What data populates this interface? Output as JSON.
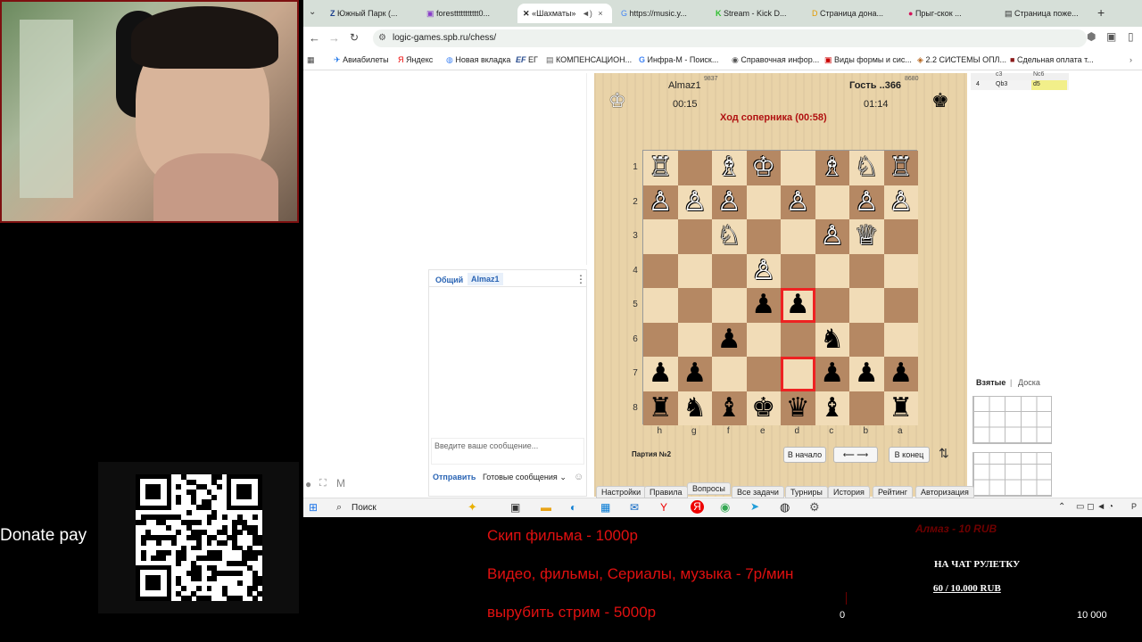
{
  "webcam": {},
  "browser": {
    "tabs": [
      {
        "label": "Южный Парк (...",
        "active": false
      },
      {
        "label": "foresttttttttttt0...",
        "active": false
      },
      {
        "label": "«Шахматы»",
        "active": true
      },
      {
        "label": "https://music.y...",
        "active": false
      },
      {
        "label": "Stream - Kick D...",
        "active": false
      },
      {
        "label": "Страница дона...",
        "active": false
      },
      {
        "label": "Прыг-скок ...",
        "active": false
      },
      {
        "label": "Страница поже...",
        "active": false
      }
    ],
    "url": "logic-games.spb.ru/chess/",
    "bookmarks": [
      "Авиабилеты",
      "Яндекс",
      "Новая вкладка",
      "ЕГ",
      "КОМПЕНСАЦИОН...",
      "Инфра-М - Поиск...",
      "Справочная инфор...",
      "Виды формы и сис...",
      "2.2 СИСТЕМЫ ОПЛ...",
      "Сдельная оплата т..."
    ]
  },
  "chat": {
    "tab_general": "Общий",
    "tab_user": "Almaz1",
    "input_placeholder": "Введите ваше сообщение...",
    "send_label": "Отправить",
    "ready_messages": "Готовые сообщения"
  },
  "game": {
    "player_left_name": "Almaz1",
    "player_left_rating": "9837",
    "player_left_time": "00:15",
    "player_right_name": "Гость ..366",
    "player_right_rating": "8680",
    "player_right_time": "01:14",
    "status": "Ход соперника (00:58)",
    "game_label": "Партия №2",
    "btn_start": "В начало",
    "btn_arrows": "⟵ ⟶",
    "btn_end": "В конец",
    "ranks": [
      "1",
      "2",
      "3",
      "4",
      "5",
      "6",
      "7",
      "8"
    ],
    "files": [
      "h",
      "g",
      "f",
      "e",
      "d",
      "c",
      "b",
      "a"
    ],
    "board": [
      [
        "wR",
        "",
        "wB",
        "wK",
        "",
        "wB",
        "wN",
        "wR"
      ],
      [
        "wP",
        "wP",
        "wP",
        "",
        "wP",
        "",
        "wP",
        "wP"
      ],
      [
        "",
        "",
        "wN",
        "",
        "",
        "wP",
        "wQ",
        ""
      ],
      [
        "",
        "",
        "",
        "wP",
        "",
        "",
        "",
        ""
      ],
      [
        "",
        "",
        "",
        "bP",
        "bP",
        "",
        "",
        ""
      ],
      [
        "",
        "",
        "bP",
        "",
        "",
        "bN",
        "",
        ""
      ],
      [
        "bP",
        "bP",
        "",
        "",
        "",
        "bP",
        "bP",
        "bP"
      ],
      [
        "bR",
        "bN",
        "bB",
        "bK",
        "bQ",
        "bB",
        "",
        "bR"
      ]
    ],
    "highlight": [
      [
        4,
        4
      ],
      [
        6,
        4
      ]
    ],
    "bottom_tabs": [
      "Настройки",
      "Правила",
      "Вопросы",
      "Все задачи",
      "Турниры",
      "История",
      "Рейтинг",
      "Авторизация"
    ]
  },
  "moves": {
    "rows": [
      {
        "num": "",
        "white": "c3",
        "black": "Nc6"
      },
      {
        "num": "4",
        "white": "Qb3",
        "black": "d5"
      }
    ]
  },
  "captured": {
    "tab_taken": "Взятые",
    "separator": "|",
    "tab_board": "Доска"
  },
  "taskbar": {
    "search_label": "Поиск"
  },
  "overlay": {
    "donate_label": "Donate pay",
    "price_skip": "Скип фильма - 1000р",
    "price_video": "Видео, фильмы, Сериалы, музыка - 7р/мин",
    "price_stop": "вырубить стрим - 5000р",
    "roulette_title": "НА ЧАТ РУЛЕТКУ",
    "roulette_amount": "60 / 10.000 RUB",
    "goal_top": "Алмаз - 10 RUB",
    "goal_min": "0",
    "goal_max": "10 000",
    "small_m": "M"
  },
  "pieces": {
    "wK": "♔",
    "wQ": "♕",
    "wR": "♖",
    "wB": "♗",
    "wN": "♘",
    "wP": "♙",
    "bK": "♚",
    "bQ": "♛",
    "bR": "♜",
    "bB": "♝",
    "bN": "♞",
    "bP": "♟"
  }
}
